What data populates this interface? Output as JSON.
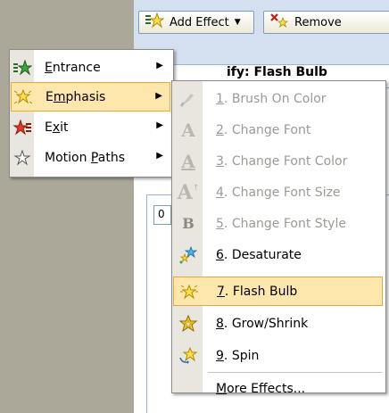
{
  "toolbar": {
    "add_effect_label": "Add Effect",
    "remove_label": "Remove"
  },
  "pane": {
    "modify_heading": "ify: Flash Bulb",
    "order_value": "0"
  },
  "main_menu": {
    "items": [
      {
        "label_pre": "",
        "label_key": "E",
        "label_post": "ntrance",
        "icon": "entrance-star-icon"
      },
      {
        "label_pre": "E",
        "label_key": "m",
        "label_post": "phasis",
        "icon": "emphasis-star-icon"
      },
      {
        "label_pre": "E",
        "label_key": "x",
        "label_post": "it",
        "icon": "exit-star-icon"
      },
      {
        "label_pre": "Motion ",
        "label_key": "P",
        "label_post": "aths",
        "icon": "motion-paths-star-icon"
      }
    ]
  },
  "sub_menu": {
    "items": [
      {
        "num": "1",
        "text": ". Brush On Color",
        "icon": "brush-on-color-icon",
        "enabled": false
      },
      {
        "num": "2",
        "text": ". Change Font",
        "icon": "change-font-icon",
        "enabled": false
      },
      {
        "num": "3",
        "text": ". Change Font Color",
        "icon": "change-font-color-icon",
        "enabled": false
      },
      {
        "num": "4",
        "text": ". Change Font Size",
        "icon": "change-font-size-icon",
        "enabled": false
      },
      {
        "num": "5",
        "text": ". Change Font Style",
        "icon": "change-font-style-icon",
        "enabled": false
      },
      {
        "num": "6",
        "text": ". Desaturate",
        "icon": "desaturate-icon",
        "enabled": true
      },
      {
        "num": "7",
        "text": ". Flash Bulb",
        "icon": "flash-bulb-icon",
        "enabled": true
      },
      {
        "num": "8",
        "text": ". Grow/Shrink",
        "icon": "grow-shrink-icon",
        "enabled": true
      },
      {
        "num": "9",
        "text": ". Spin",
        "icon": "spin-icon",
        "enabled": true
      }
    ],
    "more_pre": "",
    "more_key": "M",
    "more_post": "ore Effects..."
  },
  "colors": {
    "highlight_fill": "#fde7ac",
    "highlight_border": "#e5a934",
    "disabled_text": "#9c9a94",
    "gutter": "#e8e6de"
  }
}
